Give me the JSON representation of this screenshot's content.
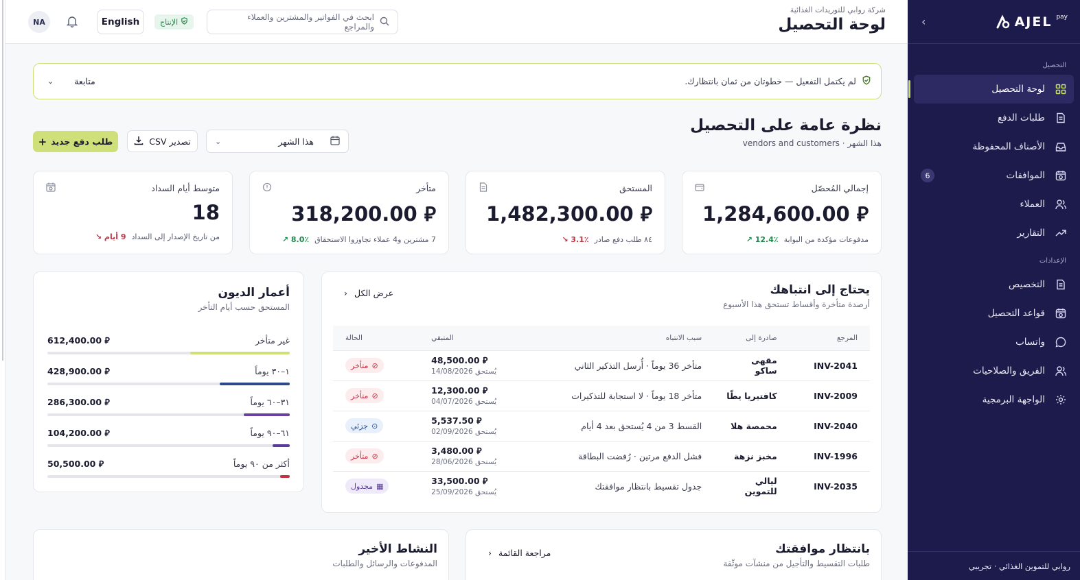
{
  "sidebar": {
    "brand": "AJEL",
    "brand_sup": "pay",
    "section_collection": "التحصيل",
    "section_settings": "الإعدادات",
    "items": [
      {
        "label": "لوحة التحصيل"
      },
      {
        "label": "طلبات الدفع"
      },
      {
        "label": "الأصناف المحفوظة"
      },
      {
        "label": "الموافقات",
        "badge": "6"
      },
      {
        "label": "العملاء"
      },
      {
        "label": "التقارير"
      }
    ],
    "settings_items": [
      {
        "label": "التخصيص"
      },
      {
        "label": "قواعد التحصيل"
      },
      {
        "label": "واتساب"
      },
      {
        "label": "الفريق والصلاحيات"
      },
      {
        "label": "الواجهة البرمجية"
      }
    ],
    "footer": "روابي للتموين الغذائي · تجريبي"
  },
  "topbar": {
    "company": "شركة روابي للتوريدات الغذائية",
    "page_title": "لوحة التحصيل",
    "search_placeholder": "ابحث في الفواتير والمشترين والعملاء والمراجع",
    "env_badge": "الإنتاج",
    "lang_button": "English",
    "avatar": "NA"
  },
  "banner": {
    "message": "لم يكتمل التفعيل — خطوتان من ثمان بانتظارك.",
    "action": "متابعة"
  },
  "overview": {
    "title": "نظرة عامة على التحصيل",
    "subtitle": "هذا الشهر · vendors and customers",
    "period": "هذا الشهر",
    "export_label": "تصدير CSV",
    "new_request_label": "طلب دفع جديد"
  },
  "kpis": [
    {
      "label": "إجمالي المُحصّل",
      "value": "1,284,600.00 ⃁",
      "delta": "12.4٪",
      "dir": "up",
      "note": "مدفوعات مؤكدة من البوابة",
      "icon": "wallet-icon"
    },
    {
      "label": "المستحق",
      "value": "1,482,300.00 ⃁",
      "delta": "3.1٪",
      "dir": "down",
      "note": "٨٤ طلب دفع صادر",
      "icon": "document-icon"
    },
    {
      "label": "متأخر",
      "value": "318,200.00 ⃁",
      "delta": "8.0٪",
      "dir": "up",
      "note": "7 مشترين و4 عملاء تجاوزوا الاستحقاق",
      "icon": "alert-circle-icon"
    },
    {
      "label": "متوسط أيام السداد",
      "value": "18",
      "delta": "9 أيام",
      "dir": "down",
      "note": "من تاريخ الإصدار إلى السداد",
      "icon": "calendar-clock-icon"
    }
  ],
  "attention": {
    "title": "يحتاج إلى انتباهك",
    "subtitle": "أرصدة متأخرة وأقساط تستحق هذا الأسبوع",
    "view_all": "عرض الكل",
    "columns": [
      "المرجع",
      "صادرة إلى",
      "سبب الانتباه",
      "المتبقي",
      "الحالة"
    ],
    "rows": [
      {
        "ref": "INV-2041",
        "to": "مقهى ساكو",
        "reason": "متأخر 36 يوماً · أُرسل التذكير الثاني",
        "amount": "48,500.00 ⃁",
        "due": "يُستحق 14/08/2026",
        "status": "متأخر",
        "kind": "late"
      },
      {
        "ref": "INV-2009",
        "to": "كافتيريا يطّا",
        "reason": "متأخر 18 يوماً · لا استجابة للتذكيرات",
        "amount": "12,300.00 ⃁",
        "due": "يُستحق 04/07/2026",
        "status": "متأخر",
        "kind": "late"
      },
      {
        "ref": "INV-2040",
        "to": "محمصة هلا",
        "reason": "القسط 3 من 4 يُستحق بعد 4 أيام",
        "amount": "5,537.50 ⃁",
        "due": "يُستحق 02/09/2026",
        "status": "جزئي",
        "kind": "partial"
      },
      {
        "ref": "INV-1996",
        "to": "مخبز نزهة",
        "reason": "فشل الدفع مرتين · رُفضت البطاقة",
        "amount": "3,480.00 ⃁",
        "due": "يُستحق 28/06/2026",
        "status": "متأخر",
        "kind": "late"
      },
      {
        "ref": "INV-2035",
        "to": "ليالي للتموين",
        "reason": "جدول تقسيط بانتظار موافقتك",
        "amount": "33,500.00 ⃁",
        "due": "يُستحق 25/09/2026",
        "status": "مجدول",
        "kind": "sched"
      }
    ]
  },
  "aging": {
    "title": "أعمار الديون",
    "subtitle": "المستحق حسب أيام التأخر",
    "rows": [
      {
        "label": "غير متأخر",
        "amount": "612,400.00 ⃁",
        "share": 0.41,
        "color": "#cfe07a"
      },
      {
        "label": "١–٣٠ يوماً",
        "amount": "428,900.00 ⃁",
        "share": 0.29,
        "color": "#2c4a8a"
      },
      {
        "label": "٣١–٦٠ يوماً",
        "amount": "286,300.00 ⃁",
        "share": 0.19,
        "color": "#6a3fa0"
      },
      {
        "label": "٦١–٩٠ يوماً",
        "amount": "104,200.00 ⃁",
        "share": 0.07,
        "color": "#5a3b9a"
      },
      {
        "label": "أكثر من ٩٠ يوماً",
        "amount": "50,500.00 ⃁",
        "share": 0.04,
        "color": "#c23344"
      }
    ]
  },
  "approvals": {
    "title": "بانتظار موافقتك",
    "subtitle": "طلبات التقسيط والتأجيل من منشآت موثّقة",
    "action": "مراجعة القائمة"
  },
  "activity": {
    "title": "النشاط الأخير",
    "subtitle": "المدفوعات والرسائل والطلبات"
  }
}
